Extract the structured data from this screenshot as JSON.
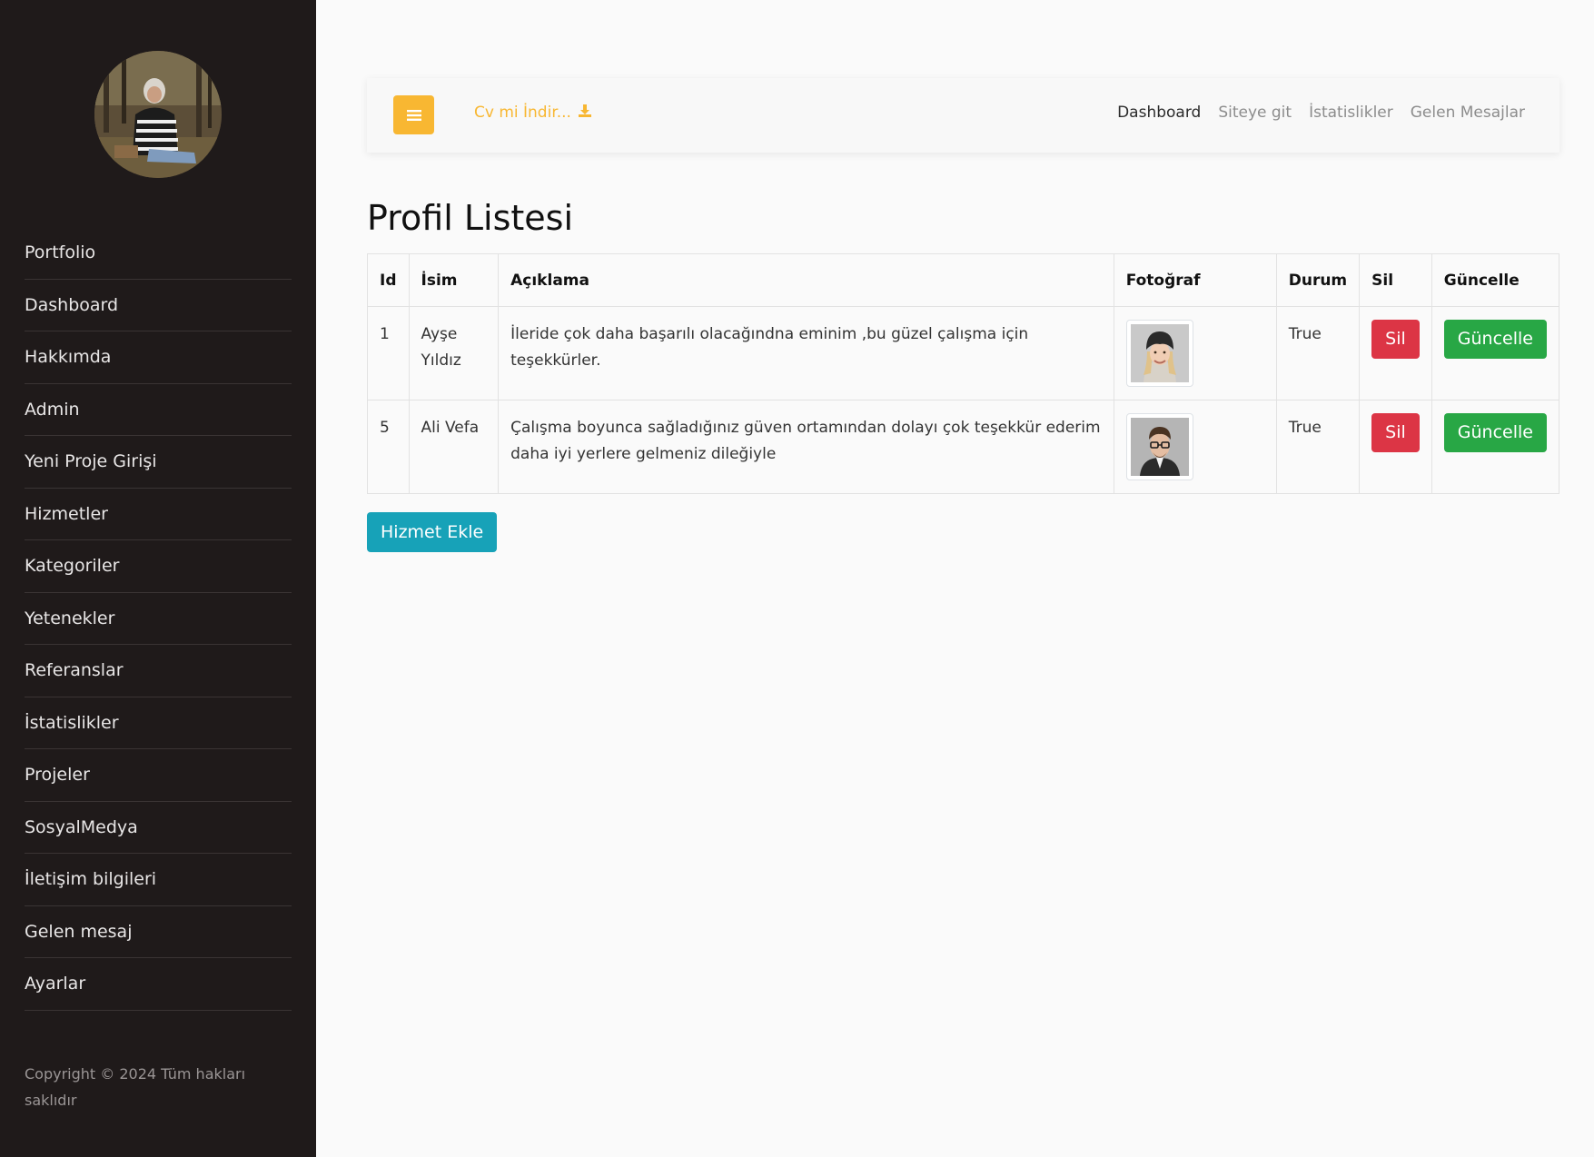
{
  "sidebar": {
    "menu": [
      "Portfolio",
      "Dashboard",
      "Hakkımda",
      "Admin",
      "Yeni Proje Girişi",
      "Hizmetler",
      "Kategoriler",
      "Yetenekler",
      "Referanslar",
      "İstatislikler",
      "Projeler",
      "SosyalMedya",
      "İletişim bilgileri",
      "Gelen mesaj",
      "Ayarlar"
    ],
    "copyright": "Copyright © 2024 Tüm hakları saklıdır"
  },
  "topbar": {
    "cv_link": "Cv mi İndir...",
    "nav": [
      "Dashboard",
      "Siteye git",
      "İstatislikler",
      "Gelen Mesajlar"
    ]
  },
  "page": {
    "title": "Profil Listesi"
  },
  "table": {
    "headers": [
      "Id",
      "İsim",
      "Açıklama",
      "Fotoğraf",
      "Durum",
      "Sil",
      "Güncelle"
    ],
    "rows": [
      {
        "id": "1",
        "name": "Ayşe Yıldız",
        "description": "İleride çok daha başarılı olacağındna eminim ,bu güzel çalışma için teşekkürler.",
        "status": "True",
        "delete_label": "Sil",
        "update_label": "Güncelle"
      },
      {
        "id": "5",
        "name": "Ali Vefa",
        "description": "Çalışma boyunca sağladığınız güven ortamından dolayı çok teşekkür ederim daha iyi yerlere gelmeniz dileğiyle",
        "status": "True",
        "delete_label": "Sil",
        "update_label": "Güncelle"
      }
    ]
  },
  "add_button": "Hizmet Ekle",
  "colors": {
    "sidebar_bg": "#1f1a1a",
    "accent_yellow": "#f8b732",
    "danger": "#dc3545",
    "success": "#28a745",
    "info": "#17a2b8"
  }
}
